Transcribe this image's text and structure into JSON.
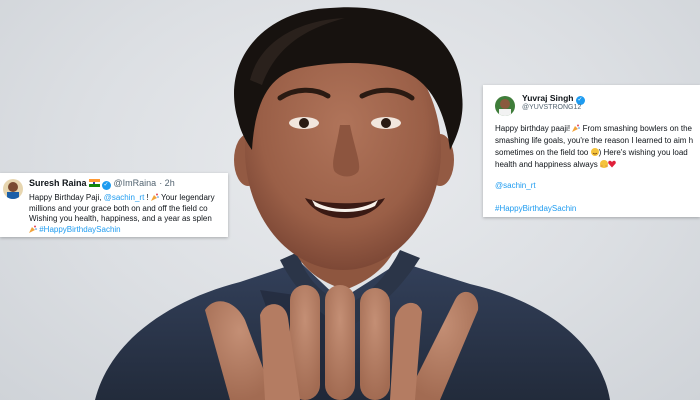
{
  "tweets": [
    {
      "name": "Suresh Raina",
      "handle": "@ImRaina",
      "time": "· 2h",
      "line1_start": "Happy Birthday Paji, ",
      "line1_mention": "@sachin_rt",
      "line1_end": " ! ",
      "line1_tail": " Your legendary",
      "line2": "millions and your grace both on and off the field co",
      "line3": "Wishing you health, happiness, and a year as splen",
      "hashtag": "#HappyBirthdaySachin",
      "emoji_icons": [
        "party-popper-icon",
        "party-popper-icon"
      ]
    },
    {
      "name": "Yuvraj Singh",
      "handle": "@YUVSTRONG12",
      "line1": "Happy birthday paaji! ",
      "line1_tail": " From smashing bowlers on the",
      "line2": "smashing life goals, you're the reason I learned to aim h",
      "line3_start": "sometimes on the field too ",
      "line3_end": ") Here's wishing you load",
      "line4": "health and happiness always ",
      "mention": "@sachin_rt",
      "hashtag": "#HappyBirthdaySachin",
      "emoji_icons": [
        "party-popper-icon",
        "laughing-face-icon",
        "hug-face-icon",
        "red-heart-icon"
      ]
    }
  ],
  "colors": {
    "link": "#1d9bf0",
    "verified": "#1d9bf0",
    "background": "#dcdfe3",
    "sweater": "#2a3447"
  }
}
